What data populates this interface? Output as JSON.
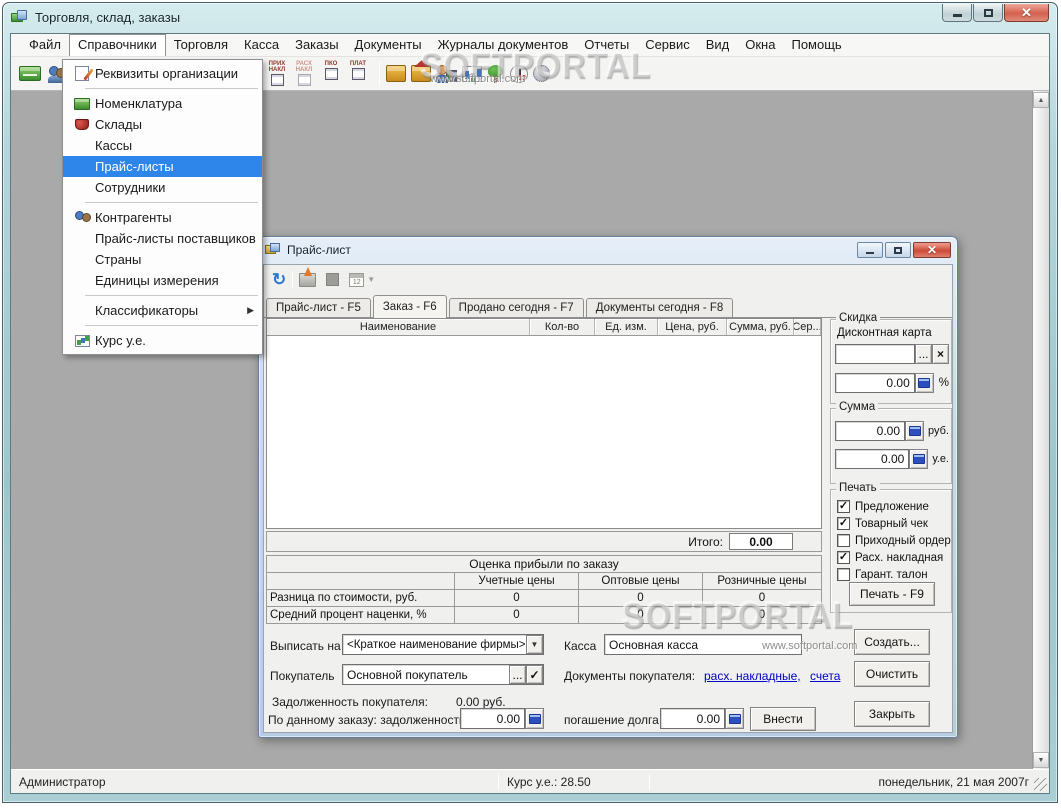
{
  "window": {
    "title": "Торговля, склад, заказы"
  },
  "watermark": {
    "brand": "SOFTPORTAL",
    "url": "www.softportal.com"
  },
  "menu": {
    "items": [
      "Файл",
      "Справочники",
      "Торговля",
      "Касса",
      "Заказы",
      "Документы",
      "Журналы документов",
      "Отчеты",
      "Сервис",
      "Вид",
      "Окна",
      "Помощь"
    ]
  },
  "dropdown": {
    "items": [
      {
        "label": "Реквизиты организации"
      },
      {
        "label": "Номенклатура"
      },
      {
        "label": "Склады"
      },
      {
        "label": "Кассы"
      },
      {
        "label": "Прайс-листы"
      },
      {
        "label": "Сотрудники"
      },
      {
        "label": "Контрагенты"
      },
      {
        "label": "Прайс-листы поставщиков"
      },
      {
        "label": "Страны"
      },
      {
        "label": "Единицы измерения"
      },
      {
        "label": "Классификаторы"
      },
      {
        "label": "Курс у.е."
      }
    ]
  },
  "toolbar": {
    "doc_icons": [
      {
        "line1": "ПРИХ",
        "line2": "НАКЛ"
      },
      {
        "line1": "РАСХ",
        "line2": "НАКЛ"
      },
      {
        "line1": "ПКО",
        "line2": ""
      },
      {
        "line1": "ПЛАТ",
        "line2": ""
      }
    ]
  },
  "price_window": {
    "title": "Прайс-лист",
    "pw_toolbar": {
      "calendar_label": "12"
    },
    "tabs": [
      {
        "label": "Прайс-лист - F5"
      },
      {
        "label": "Заказ - F6"
      },
      {
        "label": "Продано сегодня - F7"
      },
      {
        "label": "Документы сегодня - F8"
      }
    ],
    "grid": {
      "columns": [
        "Наименование",
        "Кол-во",
        "Ед. изм.",
        "Цена, руб.",
        "Сумма, руб.",
        "Сер..."
      ]
    },
    "total": {
      "label": "Итого:",
      "value": "0.00"
    },
    "profit": {
      "title": "Оценка прибыли по заказу",
      "headers": [
        "Учетные цены",
        "Оптовые цены",
        "Розничные цены"
      ],
      "rows": [
        {
          "label": "Разница по стоимости, руб.",
          "v1": "0",
          "v2": "0",
          "v3": "0"
        },
        {
          "label": "Средний процент наценки, %",
          "v1": "0",
          "v2": "0",
          "v3": "0"
        }
      ]
    },
    "discount": {
      "title": "Скидка",
      "card_label": "Дисконтная карта",
      "browse": "...",
      "clear": "×",
      "value": "0.00",
      "unit": "%"
    },
    "amount": {
      "title": "Сумма",
      "rub_value": "0.00",
      "rub_unit": "руб.",
      "ue_value": "0.00",
      "ue_unit": "у.е."
    },
    "print": {
      "title": "Печать",
      "options": [
        {
          "label": "Предложение",
          "mark": "✓"
        },
        {
          "label": "Товарный чек",
          "mark": "✓"
        },
        {
          "label": "Приходный ордер",
          "mark": ""
        },
        {
          "label": "Расх. накладная",
          "mark": "✓"
        },
        {
          "label": "Гарант. талон",
          "mark": ""
        }
      ],
      "button": "Печать - F9"
    },
    "form": {
      "issue_label": "Выписать на",
      "issue_value": "<Краткое наименование фирмы>",
      "cash_label": "Касса",
      "cash_value": "Основная касса",
      "buyer_label": "Покупатель",
      "buyer_value": "Основной покупатель",
      "buyer_check": "✓",
      "browse": "...",
      "docs_label": "Документы покупателя:",
      "docs_link1": "расх. накладные,",
      "docs_link2": "счета",
      "debt_label": "Задолженность покупателя:",
      "debt_value": "0.00 руб.",
      "order_debt_label": "По данному заказу: задолженность",
      "order_debt_value": "0.00",
      "repay_label": "погашение долга",
      "repay_value": "0.00",
      "repay_button": "Внести"
    },
    "buttons": {
      "create": "Создать...",
      "clear": "Очистить",
      "close": "Закрыть"
    }
  },
  "status": {
    "user": "Администратор",
    "rate": "Курс у.е.: 28.50",
    "date": "понедельник, 21 мая 2007г"
  }
}
